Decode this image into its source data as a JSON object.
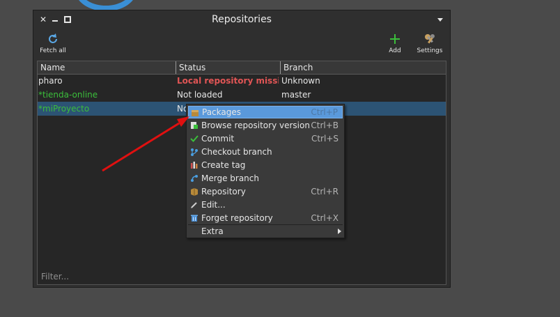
{
  "window": {
    "title": "Repositories",
    "controls": [
      "close",
      "minimize",
      "maximize"
    ]
  },
  "toolbar": {
    "fetch_all": {
      "label": "Fetch all",
      "icon": "refresh-icon"
    },
    "add": {
      "label": "Add",
      "icon": "plus-icon"
    },
    "settings": {
      "label": "Settings",
      "icon": "wrench-icon"
    }
  },
  "table": {
    "columns": [
      "Name",
      "Status",
      "Branch"
    ],
    "rows": [
      {
        "name": "pharo",
        "status": "Local repository missing",
        "branch": "Unknown"
      },
      {
        "name": "*tienda-online",
        "status": "Not loaded",
        "branch": "master"
      },
      {
        "name": "*miProyecto",
        "status": "No",
        "branch": ""
      }
    ],
    "selected_row": 2
  },
  "filter_placeholder": "Filter...",
  "context_menu": {
    "items": [
      {
        "label": "Packages",
        "shortcut": "Ctrl+P",
        "icon": "package-icon",
        "highlighted": true
      },
      {
        "label": "Browse repository version",
        "shortcut": "Ctrl+B",
        "icon": "browse-icon"
      },
      {
        "label": "Commit",
        "shortcut": "Ctrl+S",
        "icon": "checkmark-icon"
      },
      {
        "label": "Checkout branch",
        "shortcut": "",
        "icon": "branch-icon"
      },
      {
        "label": "Create tag",
        "shortcut": "",
        "icon": "tag-icon"
      },
      {
        "label": "Merge branch",
        "shortcut": "",
        "icon": "merge-icon"
      },
      {
        "label": "Repository",
        "shortcut": "Ctrl+R",
        "icon": "repository-icon"
      },
      {
        "label": "Edit...",
        "shortcut": "",
        "icon": "pencil-icon"
      },
      {
        "label": "Forget repository",
        "shortcut": "Ctrl+X",
        "icon": "trash-icon"
      }
    ],
    "submenu": {
      "label": "Extra"
    }
  },
  "colors": {
    "background": "#4a4a4a",
    "window_bg": "#2f2f2f",
    "selection": "#2c5374",
    "highlight": "#5a99db",
    "missing_status": "#e05555",
    "dirty_repo": "#3bbf3b",
    "annotation_arrow": "#e01010"
  }
}
